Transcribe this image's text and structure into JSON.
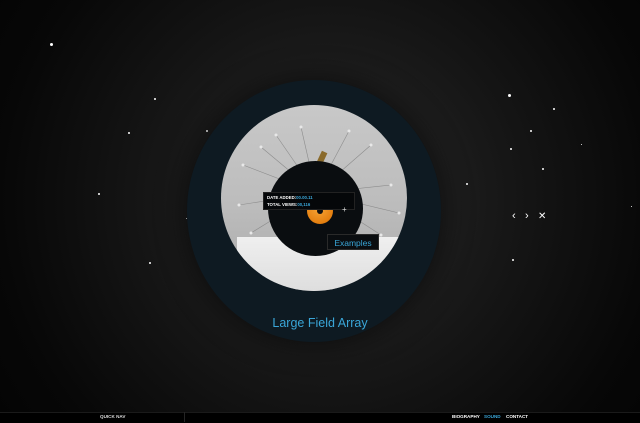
{
  "project": {
    "title": "Large Field Array"
  },
  "info_popup": {
    "date_label": "DATE ADDED:",
    "date_value": "00.00.11",
    "views_label": "TOTAL VIEWS:",
    "views_value": "00,116",
    "expand_symbol": "+"
  },
  "examples_button": {
    "label": "Examples"
  },
  "navigation": {
    "prev_symbol": "‹",
    "next_symbol": "›",
    "close_symbol": "✕"
  },
  "footer": {
    "quick_nav_label": "QUICK NAV",
    "links": [
      {
        "label": "BIOGRAPHY",
        "color": "#ffffff"
      },
      {
        "label": "SOUND",
        "color": "#3aa6d8"
      },
      {
        "label": "CONTACT",
        "color": "#ffffff"
      }
    ]
  },
  "colors": {
    "accent": "#3aa6d8",
    "background": "#0a0a0a",
    "ring": "#0e1a22"
  }
}
